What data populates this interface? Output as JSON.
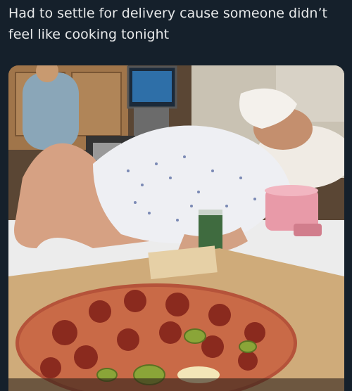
{
  "post": {
    "text": "Had to settle for delivery cause someone didn’t\nfeel like cooking tonight"
  },
  "media": {
    "colors": {
      "background": "#15202b",
      "text": "#e7e9ea"
    }
  }
}
